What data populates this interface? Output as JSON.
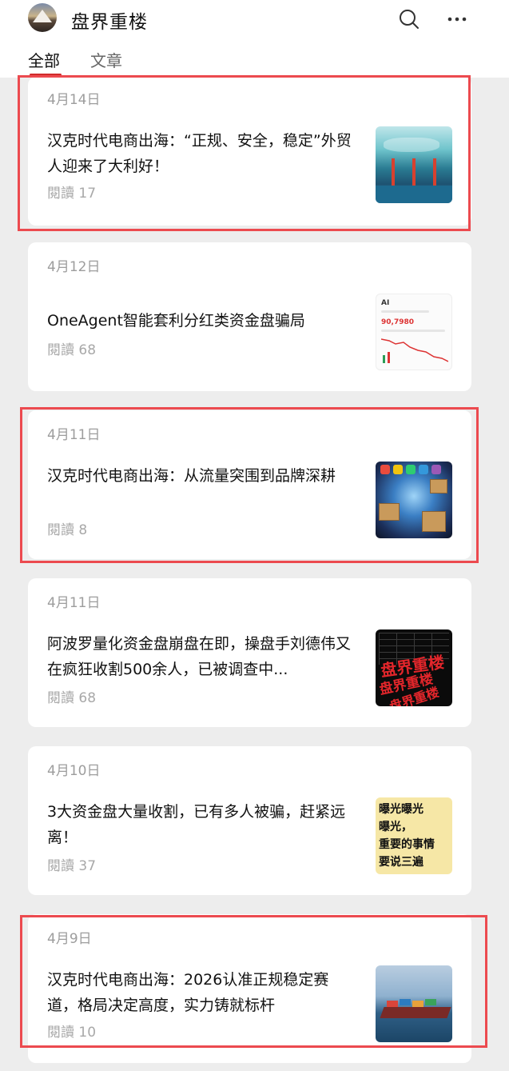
{
  "header": {
    "title": "盘界重楼",
    "avatar_icon": "mountain-avatar",
    "search_icon": "search-icon",
    "more_icon": "more-icon"
  },
  "tabs": [
    {
      "label": "全部",
      "active": true
    },
    {
      "label": "文章",
      "active": false
    }
  ],
  "accent_color": "#d12b2b",
  "highlight_color": "#ec4a4f",
  "articles": [
    {
      "date": "4月14日",
      "title": "汉克时代电商出海：“正规、安全，稳定”外贸人迎来了大利好！",
      "reads": "閱讀 17",
      "thumb": "port-map-thumbnail",
      "highlighted": true
    },
    {
      "date": "4月12日",
      "title": "OneAgent智能套利分红类资金盘骗局",
      "reads": "閱讀 68",
      "thumb": "app-screenshot-thumbnail",
      "highlighted": false,
      "thumb_text": {
        "price": "90,7980",
        "header": "AI"
      }
    },
    {
      "date": "4月11日",
      "title": "汉克时代电商出海：从流量突围到品牌深耕",
      "reads": "閱讀 8",
      "thumb": "globe-parcels-thumbnail",
      "highlighted": true
    },
    {
      "date": "4月11日",
      "title": "阿波罗量化资金盘崩盘在即，操盘手刘德伟又在疯狂收割500余人，已被调查中...",
      "reads": "閱讀 68",
      "thumb": "stamp-thumbnail",
      "highlighted": false,
      "thumb_text": {
        "stamp": "盘界重楼"
      }
    },
    {
      "date": "4月10日",
      "title": "3大资金盘大量收割，已有多人被骗，赶紧远离！",
      "reads": "閱讀 37",
      "thumb": "text-thumbnail",
      "highlighted": false,
      "thumb_text": {
        "lines": [
          "曝光曝光",
          "曝光，",
          "重要的事情",
          "要说三遍"
        ]
      }
    },
    {
      "date": "4月9日",
      "title": "汉克时代电商出海：2026认准正规稳定赛道，格局决定高度，实力铸就标杆",
      "reads": "閱讀 10",
      "thumb": "cargo-ship-thumbnail",
      "highlighted": true
    }
  ]
}
